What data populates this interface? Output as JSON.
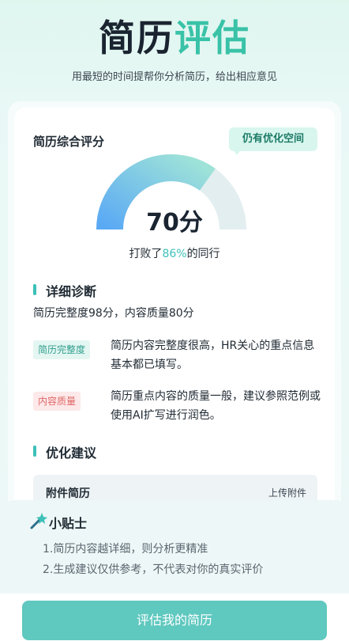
{
  "header": {
    "title_part1": "简历",
    "title_part2": "评估",
    "subtitle": "用最短的时间提帮你分析简历，给出相应意见"
  },
  "score_card": {
    "title": "简历综合评分",
    "badge": "仍有优化空间",
    "score_text": "70分",
    "score_value": 70,
    "score_max": 100,
    "beat_prefix": "打败了",
    "beat_percent": "86%",
    "beat_suffix": "的同行"
  },
  "diagnosis": {
    "title": "详细诊断",
    "summary": "简历完整度98分，内容质量80分",
    "items": [
      {
        "tag": "简历完整度",
        "text": "简历内容完整度很高，HR关心的重点信息基本都已填写。"
      },
      {
        "tag": "内容质量",
        "text": "简历重点内容的质量一般，建议参照范例或使用AI扩写进行润色。"
      }
    ]
  },
  "suggestions": {
    "title": "优化建议",
    "attachment_label": "附件简历",
    "attachment_action": "上传附件"
  },
  "tips": {
    "title": "小贴士",
    "items": [
      "1.简历内容越详细，则分析更精准",
      "2.生成建议仅供参考，不代表对你的真实评价"
    ]
  },
  "button": {
    "label": "评估我的简历"
  },
  "colors": {
    "accent": "#3cc0b8",
    "button": "#5fc8bf",
    "gauge_start": "#5aa9f5",
    "gauge_end": "#9fe3d8",
    "gauge_track": "#e3eef0"
  }
}
